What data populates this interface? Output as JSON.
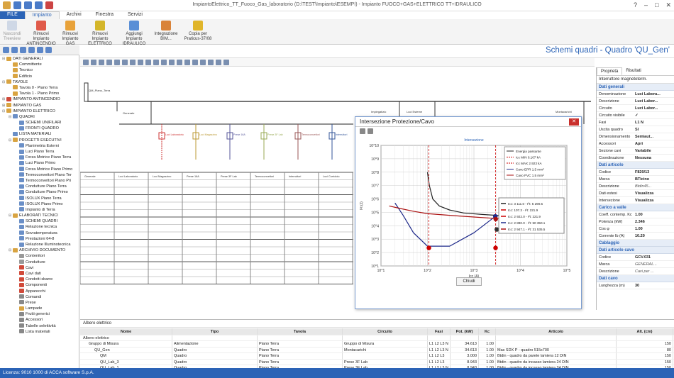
{
  "app": {
    "window_title": "ImpiantoElettrico_TT_Fuoco_Gas_laboratorio (D:\\TEST\\Impianto\\ESEMPI) - Impianto FUOCO+GAS+ELETTRICO TT+IDRAULICO"
  },
  "ribbon": {
    "tabs": [
      "FILE",
      "Impianto",
      "Archivi",
      "Finestra",
      "Servizi"
    ],
    "buttons": [
      {
        "label": "Nascondi\nTreeview"
      },
      {
        "label": "Rimuovi Impianto\nANTINCENDIO"
      },
      {
        "label": "Rimuovi\nImpianto GAS"
      },
      {
        "label": "Rimuovi Impianto\nELETTRICO"
      },
      {
        "label": "Aggiungi Impianto\nIDRAULICO"
      },
      {
        "label": "Integrazione\nBIM..."
      },
      {
        "label": "Copia per\nPraticus-37/08"
      }
    ]
  },
  "header": {
    "title": "Schemi quadri - Quadro 'QU_Gen'"
  },
  "tree": [
    {
      "d": 0,
      "t": "DATI GENERALI",
      "o": "-",
      "c": "#d9a441"
    },
    {
      "d": 1,
      "t": "Committente",
      "c": "#d9a441"
    },
    {
      "d": 1,
      "t": "Tecnico",
      "c": "#d9a441"
    },
    {
      "d": 1,
      "t": "Edificio",
      "c": "#d9a441"
    },
    {
      "d": 0,
      "t": "TAVOLE",
      "o": "-",
      "c": "#d9a441"
    },
    {
      "d": 1,
      "t": "Tavola 0 - Piano Terra",
      "c": "#d9a441"
    },
    {
      "d": 1,
      "t": "Tavola 1 - Piano Primo",
      "c": "#d9a441"
    },
    {
      "d": 0,
      "t": "IMPIANTO ANTINCENDIO",
      "o": "+",
      "c": "#d04a3a"
    },
    {
      "d": 0,
      "t": "IMPIANTO GAS",
      "o": "+",
      "c": "#d9a441"
    },
    {
      "d": 0,
      "t": "IMPIANTO ELETTRICO",
      "o": "-",
      "c": "#d9a441"
    },
    {
      "d": 1,
      "t": "QUADRI",
      "o": "-",
      "c": "#6a8fc7"
    },
    {
      "d": 2,
      "t": "SCHEMI UNIFILARI",
      "c": "#6a8fc7"
    },
    {
      "d": 2,
      "t": "FRONTI QUADRO",
      "c": "#6a8fc7"
    },
    {
      "d": 1,
      "t": "LISTA MATERIALI",
      "c": "#6a8fc7"
    },
    {
      "d": 1,
      "t": "PROGETTI ESECUTIVI",
      "o": "-",
      "c": "#d9a441"
    },
    {
      "d": 2,
      "t": "Planimetria Esterni",
      "c": "#6a8fc7"
    },
    {
      "d": 2,
      "t": "Luci Piano Terra",
      "c": "#6a8fc7"
    },
    {
      "d": 2,
      "t": "Forza Motrice Piano Terra",
      "c": "#6a8fc7"
    },
    {
      "d": 2,
      "t": "Luci Piano Primo",
      "c": "#6a8fc7"
    },
    {
      "d": 2,
      "t": "Forza Motrice Piano Primo",
      "c": "#6a8fc7"
    },
    {
      "d": 2,
      "t": "Termoconvettori Piano Ter",
      "c": "#6a8fc7"
    },
    {
      "d": 2,
      "t": "Termoconvettori Piano Pri",
      "c": "#6a8fc7"
    },
    {
      "d": 2,
      "t": "Condutture Piano Terra",
      "c": "#6a8fc7"
    },
    {
      "d": 2,
      "t": "Condutture Piano Primo",
      "c": "#6a8fc7"
    },
    {
      "d": 2,
      "t": "ISOLUX Piano Terra",
      "c": "#6a8fc7"
    },
    {
      "d": 2,
      "t": "ISOLUX Piano Primo",
      "c": "#6a8fc7"
    },
    {
      "d": 2,
      "t": "Impianto di Terra",
      "c": "#6a8fc7"
    },
    {
      "d": 1,
      "t": "ELABORATI TECNICI",
      "o": "-",
      "c": "#d9a441"
    },
    {
      "d": 2,
      "t": "SCHEMI QUADRI",
      "c": "#6a8fc7"
    },
    {
      "d": 2,
      "t": "Relazione tecnica",
      "c": "#6a8fc7"
    },
    {
      "d": 2,
      "t": "Sovratemperatura",
      "c": "#6a8fc7"
    },
    {
      "d": 2,
      "t": "Prestazioni 64-8",
      "c": "#6a8fc7"
    },
    {
      "d": 2,
      "t": "Relazione Illuminotecnica",
      "c": "#6a8fc7"
    },
    {
      "d": 1,
      "t": "ARCHIVIO DOCUMENTO",
      "o": "-",
      "c": "#d9a441"
    },
    {
      "d": 2,
      "t": "Contenitori",
      "c": "#999"
    },
    {
      "d": 2,
      "t": "Condutture",
      "c": "#999"
    },
    {
      "d": 2,
      "t": "Cavi",
      "c": "#d04a3a"
    },
    {
      "d": 2,
      "t": "Cavi dati",
      "c": "#d04a3a"
    },
    {
      "d": 2,
      "t": "Condotti sbarre",
      "c": "#d04a3a"
    },
    {
      "d": 2,
      "t": "Componenti",
      "c": "#d04a3a"
    },
    {
      "d": 2,
      "t": "Apparecchi",
      "c": "#d04a3a"
    },
    {
      "d": 2,
      "t": "Comandi",
      "c": "#888"
    },
    {
      "d": 2,
      "t": "Prese",
      "c": "#888"
    },
    {
      "d": 2,
      "t": "Lampade",
      "c": "#d9a441"
    },
    {
      "d": 2,
      "t": "Frutti generici",
      "c": "#888"
    },
    {
      "d": 2,
      "t": "Accessori",
      "c": "#888"
    },
    {
      "d": 2,
      "t": "Tabelle selettività",
      "c": "#888"
    },
    {
      "d": 2,
      "t": "Lista materiali",
      "c": "#888"
    }
  ],
  "dialog": {
    "title": "Intersezione Protezione/Cavo",
    "subtitle": "Intersezione",
    "ylabel": "I²t (J)",
    "xlabel": "Icc (A)",
    "ok_label": "Chiudi",
    "legend": [
      "Energia passante",
      "Icc MIN 0.107 kA",
      "Icc MAX 2.923 kA",
      "Cavo EPR 1.5 mm²",
      "Cavo PVC 1.5 mm²"
    ],
    "tooltip": [
      "Icc: 3 111.0 - I²t: 5 290.5",
      "Icc: 107.3 - I²t: 221.9",
      "Icc: 2 922.0 - I²t: 221.9",
      "Icc: 2 890.0 - I²t: 50 350.1",
      "Icc: 2 947.1 - I²t: 31 535.5"
    ],
    "yticks": [
      "10^10",
      "10^9",
      "10^8",
      "10^7",
      "10^6",
      "10^5",
      "10^4",
      "10^3",
      "10^2",
      "10^1"
    ],
    "xticks": [
      "10^1",
      "10^2",
      "10^3",
      "10^4",
      "10^5"
    ]
  },
  "chart_data": {
    "type": "line",
    "title": "Intersezione",
    "xlabel": "Icc (A)",
    "ylabel": "I²t (J)",
    "xscale": "log",
    "yscale": "log",
    "xlim": [
      10,
      100000
    ],
    "ylim": [
      10,
      10000000000
    ],
    "series": [
      {
        "name": "Energia passante",
        "color": "#222",
        "x": [
          100,
          110,
          130,
          180,
          300,
          600,
          1500,
          3000,
          10000,
          60000
        ],
        "y": [
          100000000,
          10000000,
          1000000,
          300000,
          150000,
          90000,
          70000,
          60000,
          55000,
          50000
        ]
      },
      {
        "name": "Cavo EPR 1.5 mm²",
        "color": "#1f2a8a",
        "x": [
          20,
          30,
          50,
          100,
          300,
          1000,
          2890
        ],
        "y": [
          500000,
          60000,
          3000,
          300,
          300,
          3000,
          50350
        ]
      },
      {
        "name": "Cavo PVC 1.5 mm²",
        "color": "#a11",
        "x": [
          15,
          25,
          50,
          100,
          300,
          1000,
          3000,
          10000,
          60000
        ],
        "y": [
          300000,
          200000,
          120000,
          80000,
          60000,
          45000,
          35000,
          32000,
          31000
        ]
      }
    ],
    "points": [
      {
        "x": 107.3,
        "y": 221.9,
        "color": "#c00"
      },
      {
        "x": 2922,
        "y": 221.9,
        "color": "#c00"
      },
      {
        "x": 2890,
        "y": 50350.1,
        "color": "#1f2a8a"
      },
      {
        "x": 2947.1,
        "y": 31535.5,
        "color": "#a11"
      },
      {
        "x": 3111,
        "y": 5290.5,
        "color": "#333"
      }
    ]
  },
  "props": {
    "tabs": [
      "Proprietà",
      "Risultati"
    ],
    "header": "Interruttore magnetoterm.",
    "sections": [
      {
        "title": "Dati generali",
        "rows": [
          [
            "Denominazione",
            "Luci Labora..."
          ],
          [
            "Descrizione",
            "Luci Labor..."
          ],
          [
            "Circuito",
            "Luci Labor..."
          ],
          [
            "Circuito visibile",
            "✓"
          ],
          [
            "Fasi",
            "L1 N"
          ],
          [
            "Uscita quadro",
            "SI"
          ],
          [
            "Dimensionamento",
            "Semiaut..."
          ],
          [
            "Accessori",
            "Apri"
          ],
          [
            "Sezione cavi",
            "Variabile"
          ],
          [
            "Coordinazione",
            "Nessuna"
          ]
        ]
      },
      {
        "title": "Dati articolo",
        "rows": [
          [
            "Codice",
            "F820/13"
          ],
          [
            "Marca",
            "BTicino"
          ],
          [
            "Descrizione",
            "Btdin45..."
          ],
          [
            "Dati estesi",
            "Visualizza"
          ],
          [
            "Intersezione",
            "Visualizza"
          ]
        ]
      },
      {
        "title": "Carico a valle",
        "rows": [
          [
            "Coeff. contemp. Kc",
            "1.00"
          ],
          [
            "Potenza (kW)",
            "2.346"
          ],
          [
            "Cos φ",
            "1.00"
          ],
          [
            "Corrente Ib (A)",
            "10.20"
          ]
        ]
      },
      {
        "title": "Cablaggio",
        "rows": []
      },
      {
        "title": "Dati articolo cavo",
        "rows": [
          [
            "Codice",
            "GCV.031"
          ],
          [
            "Marca",
            "GENERAL..."
          ],
          [
            "Descrizione",
            "Cavi per ..."
          ]
        ]
      },
      {
        "title": "Dati cavo",
        "rows": [
          [
            "Lunghezza (m)",
            "30"
          ]
        ]
      }
    ]
  },
  "schema": {
    "cols": [
      "Generale",
      "Luci Laboratorio",
      "Luci Magazzino",
      "Prese 16A",
      "Prese 3F Lab",
      "Termoconvettori",
      "Interruttori",
      "Luci Corridoio"
    ],
    "feeders": [
      "Luci Laboratorio",
      "Luci Magazzino",
      "Prese 16A",
      "Prese 3F Lab",
      "Termoconvettori",
      "Interruttori"
    ],
    "top_labels": [
      "QM_Piano_Terra",
      "Generale",
      "Impiegatizio",
      "Luci Esterne",
      "Montacarichi"
    ]
  },
  "bottom": {
    "caption": "Albero elettrico",
    "cols": [
      "Nome",
      "Tipo",
      "Tavola",
      "Circuito",
      "Fasi",
      "Pot. (kW)",
      "Kc",
      "Articolo",
      "Alt. (cm)"
    ],
    "rows": [
      [
        "Albero elettrico",
        "",
        "",
        "",
        "",
        "",
        "",
        "",
        ""
      ],
      [
        "Gruppo di Misura",
        "Alimentazione",
        "Piano Terra",
        "Gruppo di Misura",
        "L1 L2 L3 N",
        "34.613",
        "1.00",
        "",
        "150"
      ],
      [
        "QU_Gen",
        "Quadro",
        "Piano Terra",
        "Montacarichi",
        "L1 L2 L3 N",
        "34.613",
        "1.00",
        "Mas SDX P - quadro 515x700",
        "80"
      ],
      [
        "QM",
        "Quadro",
        "Piano Terra",
        "",
        "L1 L2 L3",
        "3.000",
        "1.00",
        "Btdin - quadro da parete lamiera 12 DIN",
        "150"
      ],
      [
        "QU_Lab_3",
        "Quadro",
        "Piano Terra",
        "Prese 3F Lab",
        "L1 L2 L3",
        "8.943",
        "1.00",
        "Btdin - quadro da incasso lamiera 24 DIN",
        "150"
      ],
      [
        "QU_Lab_1",
        "Quadro",
        "Piano Terra",
        "Prese 3F Lab",
        "L1 L2 L3 N",
        "8.943",
        "1.00",
        "Btdin - quadro da incasso lamiera 24 DIN",
        "150"
      ],
      [
        "QU_Lab_2",
        "Quadro",
        "Piano Terra",
        "Prese 3F Lab",
        "L1 L2 L3 N",
        "8.943",
        "1.00",
        "Btdin - quadro da incasso lamiera 24 DIN",
        "150"
      ]
    ]
  },
  "status": {
    "text": "Licenza: 9010 1000 di ACCA software S.p.A."
  }
}
